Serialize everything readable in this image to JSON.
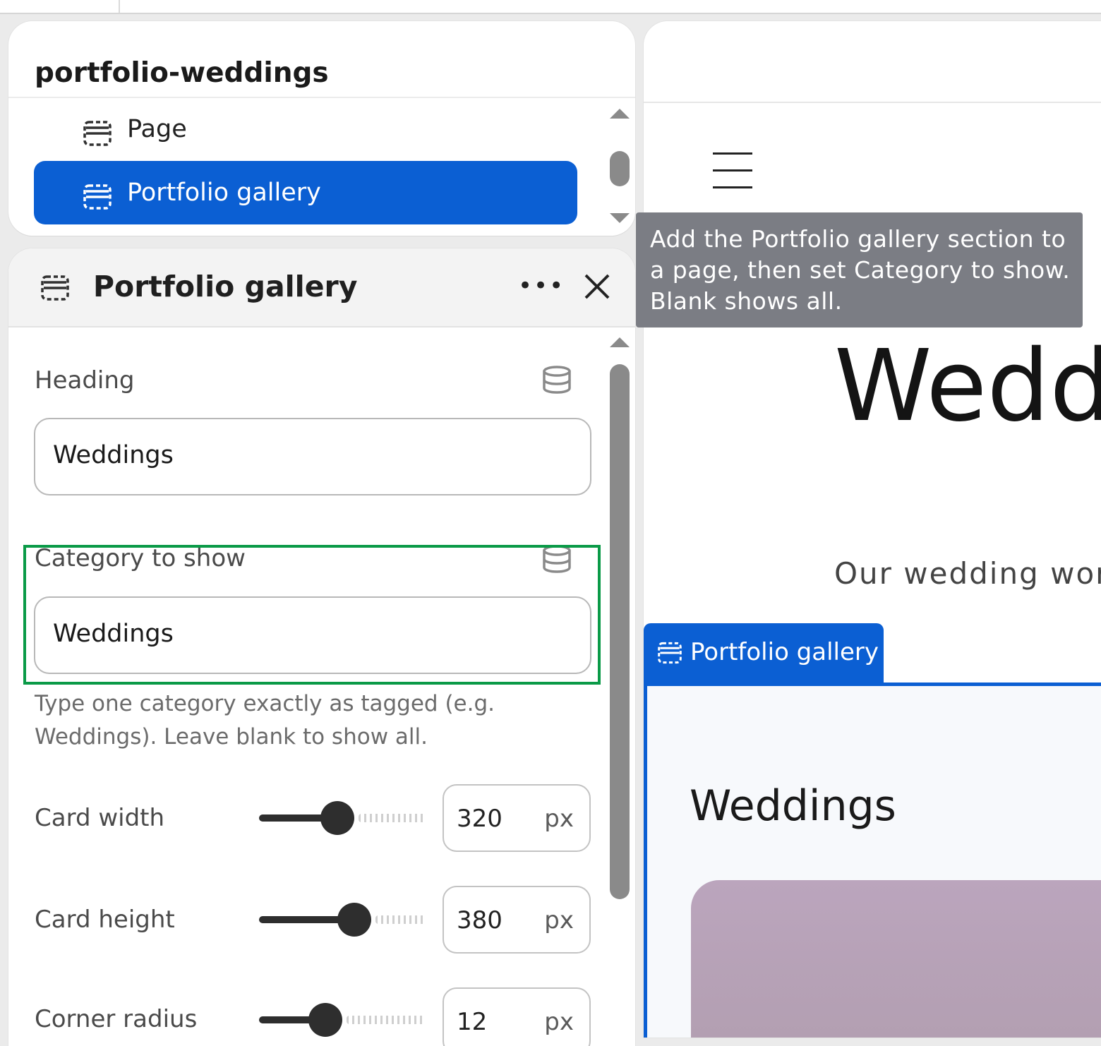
{
  "nav": {
    "title": "portfolio-weddings",
    "items": [
      {
        "label": "Page"
      },
      {
        "label": "Portfolio gallery"
      }
    ]
  },
  "settings": {
    "title": "Portfolio gallery",
    "more_label": "•••",
    "heading_label": "Heading",
    "heading_value": "Weddings",
    "category_label": "Category to show",
    "category_value": "Weddings",
    "help_text": "Type one category exactly as tagged (e.g. Weddings). Leave blank to show all.",
    "sliders": [
      {
        "label": "Card width",
        "value": "320",
        "unit": "px",
        "fraction": 0.47
      },
      {
        "label": "Card height",
        "value": "380",
        "unit": "px",
        "fraction": 0.57
      },
      {
        "label": "Corner radius",
        "value": "12",
        "unit": "px",
        "fraction": 0.4
      }
    ]
  },
  "tooltip": {
    "text": "Add the Portfolio gallery section to a page, then set Category to show. Blank shows all."
  },
  "preview": {
    "hero_title": "Wedd",
    "hero_subtitle": "Our wedding work",
    "section_tab_label": "Portfolio gallery",
    "gallery_heading": "Weddings"
  },
  "colors": {
    "accent": "#0b5fd3",
    "highlight": "#0a9a47",
    "tooltip_bg": "#7b7d84"
  },
  "icons": [
    "section-icon",
    "database-icon",
    "close-icon",
    "more-icon",
    "menu-icon"
  ]
}
